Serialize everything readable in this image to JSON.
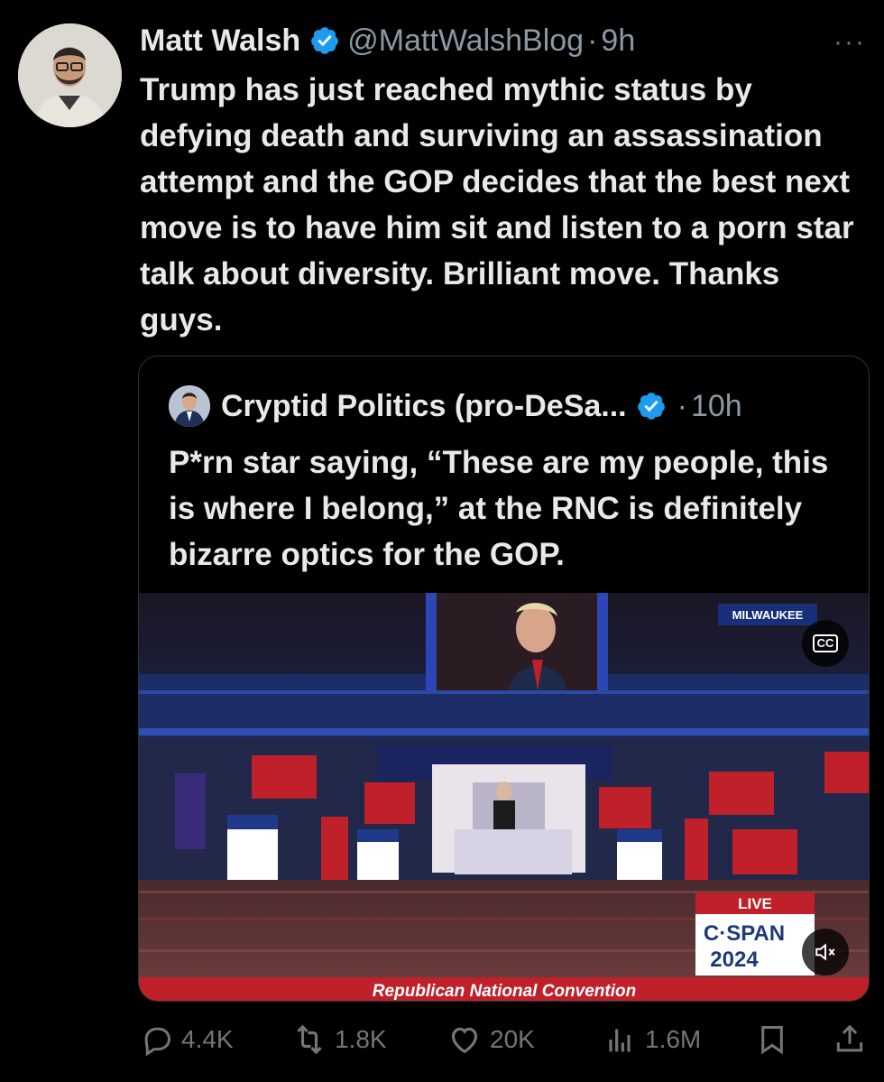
{
  "tweet": {
    "author_name": "Matt Walsh",
    "handle": "@MattWalshBlog",
    "separator": "·",
    "time": "9h",
    "more": "···",
    "text": "Trump has just reached mythic status by defying death and surviving an assassination attempt and the GOP decides that the best next move is to have him sit and listen to a porn star talk about diversity. Brilliant move. Thanks guys."
  },
  "quoted": {
    "author_name": "Cryptid Politics (pro-DeSa...",
    "separator": "·",
    "time": "10h",
    "text": "P*rn star saying, “These are my people, this is where I belong,” at the RNC is definitely bizarre optics for the GOP."
  },
  "video": {
    "location_tag": "MILWAUKEE",
    "cc_label": "CC",
    "live_label": "LIVE",
    "network": "C·SPAN",
    "year": "2024",
    "lower_third": "Republican National Convention"
  },
  "actions": {
    "replies": "4.4K",
    "reposts": "1.8K",
    "likes": "20K",
    "views": "1.6M"
  },
  "colors": {
    "verified": "#1d9bf0",
    "muted_text": "#71767b",
    "border": "#2f3336",
    "convention_red": "#c0202a",
    "convention_blue": "#1f3a8a"
  },
  "icons": [
    "verified-badge-icon",
    "more-icon",
    "cc-icon",
    "mute-icon",
    "reply-icon",
    "repost-icon",
    "like-icon",
    "views-icon",
    "bookmark-icon",
    "share-icon"
  ]
}
